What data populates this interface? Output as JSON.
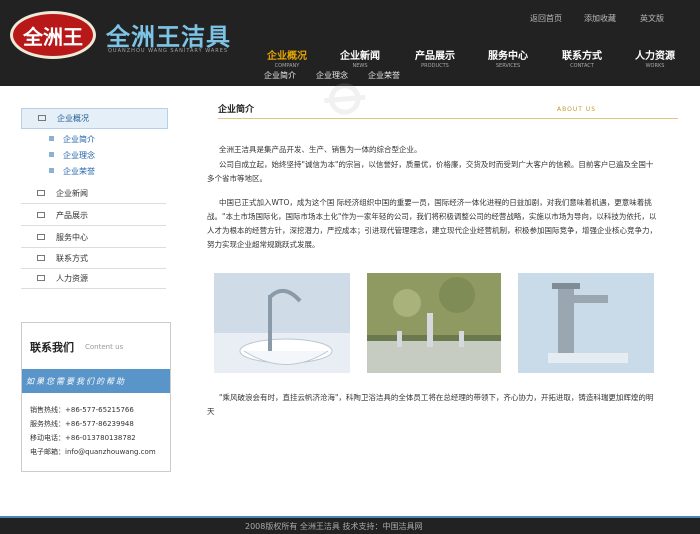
{
  "header": {
    "logo_text": "全洲王",
    "brand_cn": "全洲王洁具",
    "brand_en": "QUANZHOU WANG SANITARY WARES",
    "top_links": [
      "返回首页",
      "添加收藏",
      "英文版"
    ]
  },
  "nav": [
    {
      "cn": "企业概况",
      "en": "COMPANY",
      "active": true
    },
    {
      "cn": "企业新闻",
      "en": "NEWS"
    },
    {
      "cn": "产品展示",
      "en": "PRODUCTS"
    },
    {
      "cn": "服务中心",
      "en": "SERVICES"
    },
    {
      "cn": "联系方式",
      "en": "CONTACT"
    },
    {
      "cn": "人力资源",
      "en": "WORKS"
    }
  ],
  "subnav": [
    "企业简介",
    "企业理念",
    "企业荣誉"
  ],
  "sidebar": {
    "items": [
      "企业概况",
      "企业新闻",
      "产品展示",
      "服务中心",
      "联系方式",
      "人力资源"
    ],
    "sub_items": [
      "企业简介",
      "企业理念",
      "企业荣誉"
    ]
  },
  "contact": {
    "title": "联系我们",
    "subtitle": "Content us",
    "banner": "如果您需要我们的帮助",
    "lines": [
      "销售热线：+86-577-65215766",
      "服务热线：+86-577-86239948",
      "移动电话：+86-013780138782",
      "电子邮箱：info@quanzhouwang.com"
    ]
  },
  "content": {
    "title": "企业简介",
    "title_en": "ABOUT US",
    "paragraphs": [
      "全洲王洁具是集产品开发、生产、销售为一体的综合型企业。",
      "公司自成立起，始终坚持\"诚信为本\"的宗旨，以信誉好，质量优，价格廉，交货及时而受到广大客户的信赖。目前客户已遍及全国十多个省市等地区。",
      "中国已正式加入WTO，成为这个国 际经济组织中国的重要一员，国际经济一体化进程的日益加剧，对我们意味着机遇，更意味着挑战。\"本土市场国际化，国际市场本土化\"作为一家年轻的公司，我们将积极调整公司的经营战略，实施以市场为导向，以科技为依托，以人才为根本的经营方针，深挖潜力，严控成本；引进现代管理理念，建立现代企业经营机制，积极参加国际竞争，增强企业核心竞争力，努力实现企业超常规跳跃式发展。",
      "\"乘风破浪会有时，直挂云帆济沧海\"，科陶卫浴洁具的全体员工将在总经理的带领下，齐心协力，开拓进取，铸造科瑞更加辉煌的明天"
    ]
  },
  "footer": {
    "text": "2008版权所有 全洲王洁具    技术支持：中国洁具网"
  },
  "colors": {
    "header_bg": "#222222",
    "nav_active": "#e3a400",
    "accent_blue": "#5a95c9",
    "logo_red": "#b81818"
  }
}
